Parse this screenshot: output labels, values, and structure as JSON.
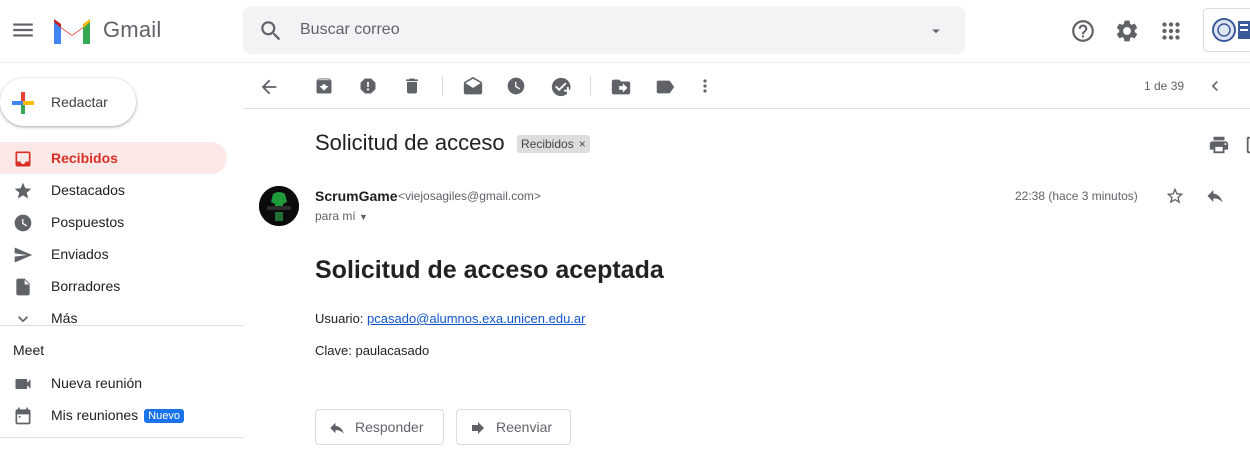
{
  "app": {
    "name": "Gmail"
  },
  "search": {
    "placeholder": "Buscar correo"
  },
  "sidebar": {
    "compose_label": "Redactar",
    "items": [
      {
        "label": "Recibidos",
        "icon": "inbox-icon",
        "active": true
      },
      {
        "label": "Destacados",
        "icon": "star-icon"
      },
      {
        "label": "Pospuestos",
        "icon": "clock-icon"
      },
      {
        "label": "Enviados",
        "icon": "send-icon"
      },
      {
        "label": "Borradores",
        "icon": "draft-icon"
      },
      {
        "label": "Más",
        "icon": "chevron-down-icon"
      }
    ],
    "meet": {
      "title": "Meet",
      "items": [
        {
          "label": "Nueva reunión",
          "icon": "video-icon"
        },
        {
          "label": "Mis reuniones",
          "icon": "calendar-icon",
          "badge": "Nuevo"
        }
      ]
    }
  },
  "toolbar": {
    "icons": [
      "back-arrow-icon",
      "archive-icon",
      "report-spam-icon",
      "delete-icon",
      "mark-unread-icon",
      "snooze-icon",
      "add-task-icon",
      "move-to-icon",
      "label-icon",
      "more-icon"
    ],
    "pager": "1 de 39"
  },
  "message": {
    "subject": "Solicitud de acceso",
    "label_chip": "Recibidos",
    "sender_name": "ScrumGame",
    "sender_email": "<viejosagiles@gmail.com>",
    "to": "para mí",
    "time": "22:38 (hace 3 minutos)",
    "body": {
      "heading": "Solicitud de acceso aceptada",
      "user_label": "Usuario: ",
      "user_value": "pcasado@alumnos.exa.unicen.edu.ar",
      "password_line": "Clave: paulacasado"
    },
    "reply_label": "Responder",
    "forward_label": "Reenviar"
  },
  "colors": {
    "accent": "#d93025",
    "active_bg": "#fce8e6",
    "badge": "#1a73e8",
    "link": "#1155cc"
  }
}
